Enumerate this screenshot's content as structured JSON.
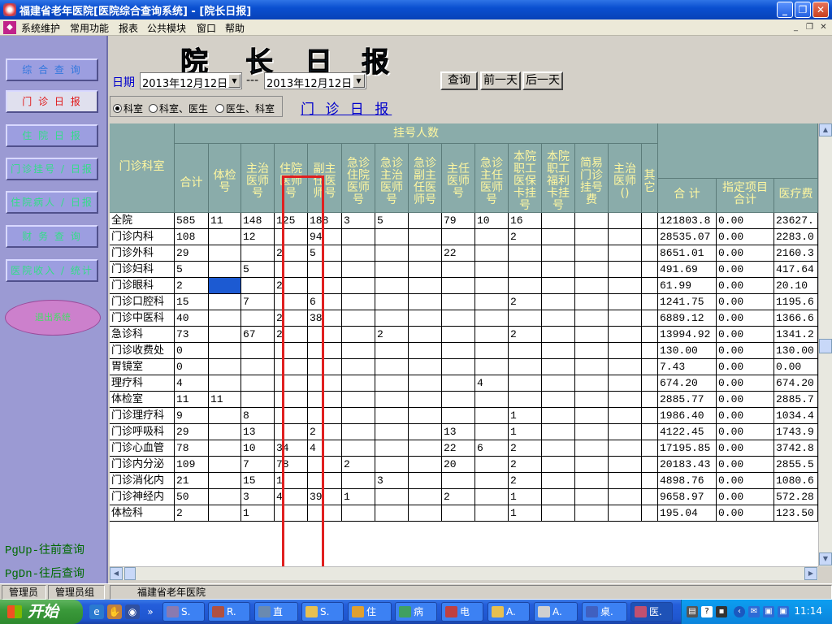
{
  "window": {
    "title": "福建省老年医院[医院综合查询系统] - [院长日报]"
  },
  "menu": [
    "系统维护",
    "常用功能",
    "报表",
    "公共模块",
    "窗口",
    "帮助"
  ],
  "sidebar": {
    "buttons": [
      "综 合 查 询",
      "门 诊 日 报",
      "住 院 日 报",
      "门诊挂号 / 日报",
      "住院病人 / 日报",
      "财 务 查 询",
      "医院收入 / 统计"
    ],
    "oval_label": "退出系统",
    "pgup": "PgUp-往前查询",
    "pgdn": "PgDn-往后查询"
  },
  "report": {
    "big_title": [
      "院",
      "长",
      "日",
      "报"
    ],
    "date_label": "日期",
    "date_from": "2013年12月12日",
    "date_sep": "---",
    "date_to": "2013年12月12日",
    "buttons": {
      "query": "查询",
      "prev_day": "前一天",
      "next_day": "后一天"
    },
    "radios": [
      "科室",
      "科室、医生",
      "医生、科室"
    ],
    "selected_radio": "科室",
    "sub_title": "门 诊 日 报"
  },
  "table": {
    "group_header": "挂号人数",
    "dept_header": "门诊科室",
    "columns": [
      [
        "合计"
      ],
      [
        "体检",
        "号"
      ],
      [
        "主治",
        "医师",
        "号"
      ],
      [
        "住院",
        "医师",
        "号"
      ],
      [
        "副主",
        "任医",
        "师号"
      ],
      [
        "急诊",
        "住院",
        "医师",
        "号"
      ],
      [
        "急诊",
        "主治",
        "医师",
        "号"
      ],
      [
        "急诊",
        "副主",
        "任医",
        "师号"
      ],
      [
        "主任",
        "医师",
        "号"
      ],
      [
        "急诊",
        "主任",
        "医师",
        "号"
      ],
      [
        "本院",
        "职工",
        "医保",
        "卡挂",
        "号"
      ],
      [
        "本院",
        "职工",
        "福利",
        "卡挂",
        "号"
      ],
      [
        "简易",
        "门诊",
        "挂号",
        "费"
      ],
      [
        "主治",
        "医师",
        "()"
      ],
      [
        "其",
        "它"
      ]
    ],
    "right_columns": [
      [
        "合  计"
      ],
      [
        "指定项目",
        "合计"
      ],
      [
        "医疗费"
      ]
    ],
    "rows": [
      {
        "dept": "全院",
        "vals": [
          "585",
          "11",
          "148",
          "125",
          "188",
          "3",
          "5",
          "",
          "79",
          "10",
          "16",
          "",
          "",
          "",
          ""
        ],
        "right": [
          "121803.8",
          "0.00",
          "23627."
        ]
      },
      {
        "dept": "门诊内科",
        "vals": [
          "108",
          "",
          "12",
          "",
          "94",
          "",
          "",
          "",
          "",
          "",
          "2",
          "",
          "",
          "",
          ""
        ],
        "right": [
          "28535.07",
          "0.00",
          "2283.0"
        ]
      },
      {
        "dept": "门诊外科",
        "vals": [
          "29",
          "",
          "",
          "2",
          "5",
          "",
          "",
          "",
          "22",
          "",
          "",
          "",
          "",
          "",
          ""
        ],
        "right": [
          "8651.01",
          "0.00",
          "2160.3"
        ]
      },
      {
        "dept": "门诊妇科",
        "vals": [
          "5",
          "",
          "5",
          "",
          "",
          "",
          "",
          "",
          "",
          "",
          "",
          "",
          "",
          "",
          ""
        ],
        "right": [
          "491.69",
          "0.00",
          "417.64"
        ]
      },
      {
        "dept": "门诊眼科",
        "vals": [
          "2",
          "",
          "",
          "2",
          "",
          "",
          "",
          "",
          "",
          "",
          "",
          "",
          "",
          "",
          ""
        ],
        "right": [
          "61.99",
          "0.00",
          "20.10"
        ]
      },
      {
        "dept": "门诊口腔科",
        "vals": [
          "15",
          "",
          "7",
          "",
          "6",
          "",
          "",
          "",
          "",
          "",
          "2",
          "",
          "",
          "",
          ""
        ],
        "right": [
          "1241.75",
          "0.00",
          "1195.6"
        ]
      },
      {
        "dept": "门诊中医科",
        "vals": [
          "40",
          "",
          "",
          "2",
          "38",
          "",
          "",
          "",
          "",
          "",
          "",
          "",
          "",
          "",
          ""
        ],
        "right": [
          "6889.12",
          "0.00",
          "1366.6"
        ]
      },
      {
        "dept": "急诊科",
        "vals": [
          "73",
          "",
          "67",
          "2",
          "",
          "",
          "2",
          "",
          "",
          "",
          "2",
          "",
          "",
          "",
          ""
        ],
        "right": [
          "13994.92",
          "0.00",
          "1341.2"
        ]
      },
      {
        "dept": "门诊收费处",
        "vals": [
          "0",
          "",
          "",
          "",
          "",
          "",
          "",
          "",
          "",
          "",
          "",
          "",
          "",
          "",
          ""
        ],
        "right": [
          "130.00",
          "0.00",
          "130.00"
        ]
      },
      {
        "dept": "胃镜室",
        "vals": [
          "0",
          "",
          "",
          "",
          "",
          "",
          "",
          "",
          "",
          "",
          "",
          "",
          "",
          "",
          ""
        ],
        "right": [
          "7.43",
          "0.00",
          "0.00"
        ]
      },
      {
        "dept": "理疗科",
        "vals": [
          "4",
          "",
          "",
          "",
          "",
          "",
          "",
          "",
          "",
          "4",
          "",
          "",
          "",
          "",
          ""
        ],
        "right": [
          "674.20",
          "0.00",
          "674.20"
        ]
      },
      {
        "dept": "体检室",
        "vals": [
          "11",
          "11",
          "",
          "",
          "",
          "",
          "",
          "",
          "",
          "",
          "",
          "",
          "",
          "",
          ""
        ],
        "right": [
          "2885.77",
          "0.00",
          "2885.7"
        ]
      },
      {
        "dept": "门诊理疗科",
        "vals": [
          "9",
          "",
          "8",
          "",
          "",
          "",
          "",
          "",
          "",
          "",
          "1",
          "",
          "",
          "",
          ""
        ],
        "right": [
          "1986.40",
          "0.00",
          "1034.4"
        ]
      },
      {
        "dept": "门诊呼吸科",
        "vals": [
          "29",
          "",
          "13",
          "",
          "2",
          "",
          "",
          "",
          "13",
          "",
          "1",
          "",
          "",
          "",
          ""
        ],
        "right": [
          "4122.45",
          "0.00",
          "1743.9"
        ]
      },
      {
        "dept": "门诊心血管",
        "vals": [
          "78",
          "",
          "10",
          "34",
          "4",
          "",
          "",
          "",
          "22",
          "6",
          "2",
          "",
          "",
          "",
          ""
        ],
        "right": [
          "17195.85",
          "0.00",
          "3742.8"
        ]
      },
      {
        "dept": "门诊内分泌",
        "vals": [
          "109",
          "",
          "7",
          "78",
          "",
          "2",
          "",
          "",
          "20",
          "",
          "2",
          "",
          "",
          "",
          ""
        ],
        "right": [
          "20183.43",
          "0.00",
          "2855.5"
        ]
      },
      {
        "dept": "门诊消化内",
        "vals": [
          "21",
          "",
          "15",
          "1",
          "",
          "",
          "3",
          "",
          "",
          "",
          "2",
          "",
          "",
          "",
          ""
        ],
        "right": [
          "4898.76",
          "0.00",
          "1080.6"
        ]
      },
      {
        "dept": "门诊神经内",
        "vals": [
          "50",
          "",
          "3",
          "4",
          "39",
          "1",
          "",
          "",
          "2",
          "",
          "1",
          "",
          "",
          "",
          ""
        ],
        "right": [
          "9658.97",
          "0.00",
          "572.28"
        ]
      },
      {
        "dept": "体检科",
        "vals": [
          "2",
          "",
          "1",
          "",
          "",
          "",
          "",
          "",
          "",
          "",
          "1",
          "",
          "",
          "",
          ""
        ],
        "right": [
          "195.04",
          "0.00",
          "123.50"
        ]
      }
    ]
  },
  "status": {
    "user": "管理员",
    "group": "管理员组",
    "org": "福建省老年医院"
  },
  "taskbar": {
    "start": "开始",
    "items": [
      "S.",
      "R.",
      "直",
      "S.",
      "住",
      "病",
      "电",
      "A.",
      "A.",
      "桌.",
      "医."
    ],
    "clock": "11:14"
  }
}
